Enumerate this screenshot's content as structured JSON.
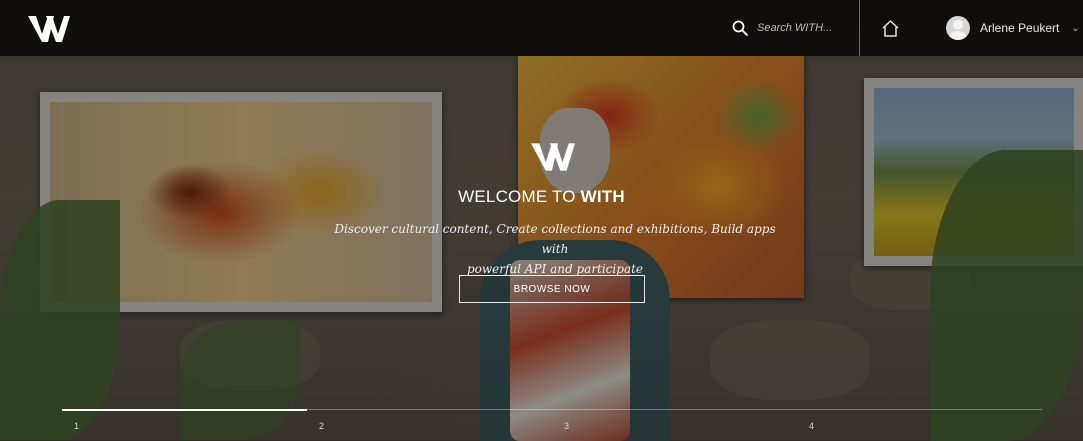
{
  "header": {
    "search": {
      "placeholder": "Search WITH..."
    },
    "user": {
      "name": "Arlene Peukert"
    }
  },
  "hero": {
    "welcome_prefix": "WELCOME TO ",
    "welcome_brand": "WITH",
    "tagline_line1": "Discover cultural content, Create collections and exhibitions, Build apps with",
    "tagline_line2": "powerful API and participate",
    "browse_label": "BROWSE NOW"
  },
  "slider": {
    "items": [
      {
        "label": "1"
      },
      {
        "label": "2"
      },
      {
        "label": "3"
      },
      {
        "label": "4"
      }
    ],
    "active_index": 0
  },
  "colors": {
    "topbar_bg": "#000000",
    "text_primary": "#ffffff"
  },
  "icons": [
    "with-logo-icon",
    "search-icon",
    "home-icon",
    "avatar-icon",
    "chevron-down-icon"
  ]
}
